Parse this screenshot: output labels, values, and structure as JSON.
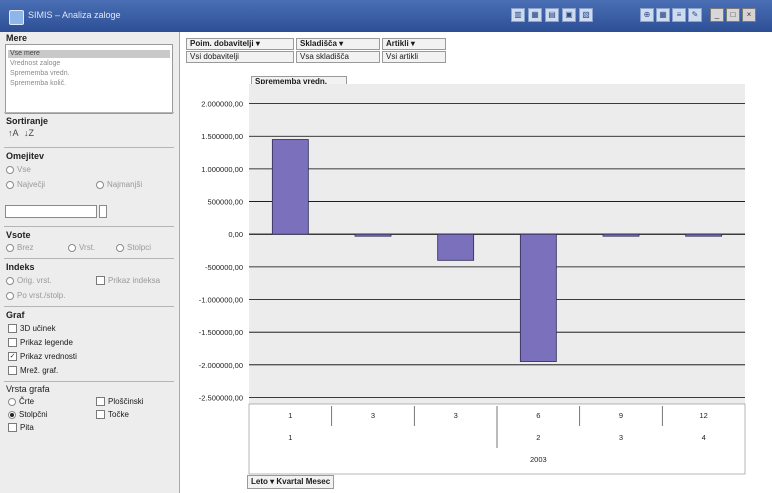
{
  "window": {
    "title": "SIMIS – Analiza zaloge",
    "toolbar_icons": [
      "chart-icon",
      "table-icon",
      "print-icon",
      "export-icon",
      "filter-icon"
    ],
    "tools_icons": [
      "zoom-icon",
      "grid-icon",
      "legend-icon",
      "tool-icon"
    ],
    "controls": {
      "minimize": "_",
      "maximize": "□",
      "close": "×"
    }
  },
  "sidebar": {
    "measures": {
      "title": "Mere",
      "items": [
        "Vse mere",
        "Vrednost zaloge",
        "Sprememba vredn.",
        "Sprememba količ."
      ]
    },
    "sort": {
      "title": "Sortiranje",
      "asc_glyph": "↑A",
      "desc_glyph": "↓Z"
    },
    "limit": {
      "title": "Omejitev",
      "all_label": "Vse",
      "top_label": "Največji",
      "bottom_label": "Najmanjši",
      "value": ""
    },
    "sum": {
      "title": "Vsote",
      "none_label": "Brez",
      "row_label": "Vrst.",
      "col_label": "Stolpci"
    },
    "index": {
      "title": "Indeks",
      "opt1": "Orig. vrst.",
      "opt2": "Prikaz indeksa",
      "opt3": "Po vrst./stolp."
    },
    "graph": {
      "title": "Graf",
      "opt_3d": "3D učinek",
      "opt_legend": "Prikaz legende",
      "opt_values": "Prikaz vrednosti",
      "opt_grid": "Mrež. graf.",
      "checked_values": true
    },
    "graph_type": {
      "title": "Vrsta grafa",
      "line": "Črte",
      "area": "Ploščinski",
      "bar": "Stolpčni",
      "point": "Točke",
      "pie": "Pita",
      "selected": "bar"
    }
  },
  "filters": [
    {
      "label": "Poim. dobavitelji",
      "value": "Vsi dobavitelji"
    },
    {
      "label": "Skladišča",
      "value": "Vsa skladišča"
    },
    {
      "label": "Artikli",
      "value": "Vsi artikli"
    }
  ],
  "pivot_fields": {
    "month": "Mesec",
    "quarter": "Kvartal",
    "year": "Leto"
  },
  "chart_data": {
    "type": "bar",
    "series": [
      {
        "name": "Sprememba vredn.",
        "values": [
          1450000,
          -28000,
          -400000,
          -1950000,
          -12000,
          -12000
        ]
      }
    ],
    "categories": [
      "1",
      "3",
      "3",
      "6",
      "9",
      "12"
    ],
    "quarters": [
      "1",
      "",
      "",
      "2",
      "3",
      "4"
    ],
    "year": "2003",
    "ylim": [
      -2600000,
      2300000
    ],
    "yticks": [
      2000000,
      1500000,
      1000000,
      500000,
      0,
      -500000,
      -1000000,
      -1500000,
      -2000000,
      -2500000
    ],
    "ytick_labels": [
      "2.000000,00",
      "1.500000,00",
      "1.000000,00",
      "500000,00",
      "0,00",
      "-500000,00",
      "-1.000000,00",
      "-1.500000,00",
      "-2.000000,00",
      "-2.500000,00"
    ],
    "bar_color": "#7a70bc",
    "grid": true
  }
}
